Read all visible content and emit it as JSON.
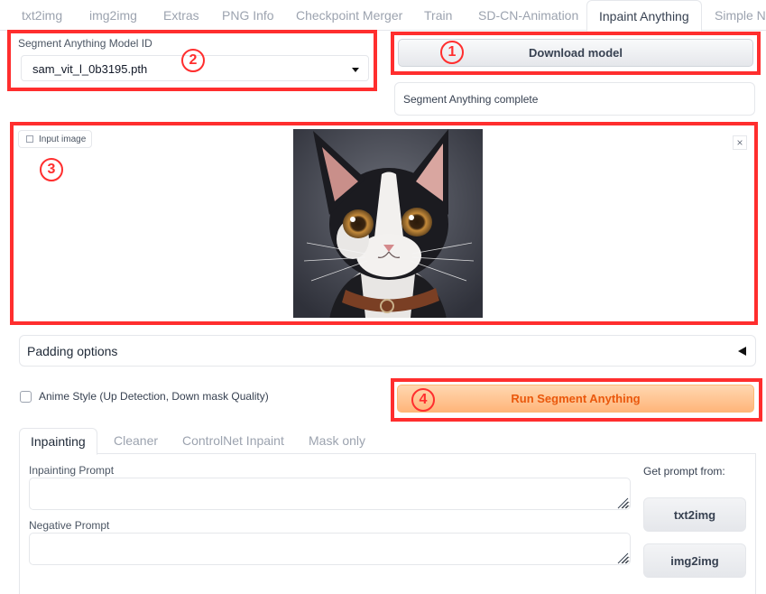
{
  "tabs": [
    {
      "label": "txt2img"
    },
    {
      "label": "img2img"
    },
    {
      "label": "Extras"
    },
    {
      "label": "PNG Info"
    },
    {
      "label": "Checkpoint Merger"
    },
    {
      "label": "Train"
    },
    {
      "label": "SD-CN-Animation"
    },
    {
      "label": "Inpaint Anything",
      "active": true
    },
    {
      "label": "Simple No"
    }
  ],
  "model": {
    "label": "Segment Anything Model ID",
    "selected": "sam_vit_l_0b3195.pth"
  },
  "download_button": "Download model",
  "status": "Segment Anything complete",
  "input_image": {
    "label": "Input image",
    "close": "×"
  },
  "padding_options": "Padding options",
  "anime_style": {
    "label": "Anime Style (Up Detection, Down mask Quality)",
    "checked": false
  },
  "run_button": "Run Segment Anything",
  "subtabs": [
    {
      "label": "Inpainting",
      "active": true
    },
    {
      "label": "Cleaner"
    },
    {
      "label": "ControlNet Inpaint"
    },
    {
      "label": "Mask only"
    }
  ],
  "inpainting": {
    "prompt_label": "Inpainting Prompt",
    "prompt_value": "",
    "negative_label": "Negative Prompt",
    "negative_value": "",
    "get_prompt_label": "Get prompt from:",
    "txt2img_button": "txt2img",
    "img2img_button": "img2img"
  },
  "annotations": [
    "1",
    "2",
    "3",
    "4"
  ],
  "colors": {
    "annotation": "#ff2e2e",
    "run_button_text": "#ea580c",
    "run_button_bg": "#ffc08a"
  }
}
